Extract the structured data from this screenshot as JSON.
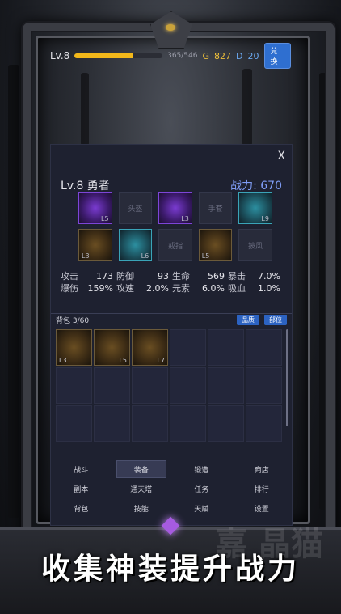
{
  "topbar": {
    "level": "Lv.8",
    "xp_fraction": 0.667,
    "xp_text": "365/546",
    "gold_label": "G",
    "gold": "827",
    "diamond_label": "D",
    "diamond": "20",
    "exchange_button": "兑换"
  },
  "panel": {
    "close": "X",
    "hero": "Lv.8 勇者",
    "power": "战力: 670",
    "slots_row1": [
      {
        "label": "",
        "level": "L5",
        "style": "purple"
      },
      {
        "label": "头盔",
        "level": "",
        "style": "empty"
      },
      {
        "label": "",
        "level": "L3",
        "style": "purple"
      },
      {
        "label": "手套",
        "level": "",
        "style": "empty"
      },
      {
        "label": "",
        "level": "L9",
        "style": "teal"
      }
    ],
    "slots_row2": [
      {
        "label": "",
        "level": "L3",
        "style": "bronze"
      },
      {
        "label": "",
        "level": "L6",
        "style": "teal"
      },
      {
        "label": "戒指",
        "level": "",
        "style": "empty"
      },
      {
        "label": "",
        "level": "L5",
        "style": "bronze"
      },
      {
        "label": "披风",
        "level": "",
        "style": "empty"
      }
    ],
    "stats_row1": [
      "攻击",
      "173",
      "防御",
      "93",
      "生命",
      "569",
      "暴击",
      "7.0%"
    ],
    "stats_row2": [
      "爆伤",
      "159%",
      "攻速",
      "2.0%",
      "元素",
      "6.0%",
      "吸血",
      "1.0%"
    ],
    "bag_label": "背包 3/60",
    "bag_sort_quality": "品质",
    "bag_sort_part": "部位",
    "bag_items": [
      {
        "level": "L3"
      },
      {
        "level": "L5"
      },
      {
        "level": "L7"
      }
    ],
    "menu": [
      "战斗",
      "装备",
      "锻造",
      "商店",
      "副本",
      "通天塔",
      "任务",
      "排行",
      "背包",
      "技能",
      "天赋",
      "设置"
    ],
    "menu_active": "装备"
  },
  "banner": {
    "slogan": "收集神装提升战力",
    "watermark": "嘉 晶猫"
  }
}
